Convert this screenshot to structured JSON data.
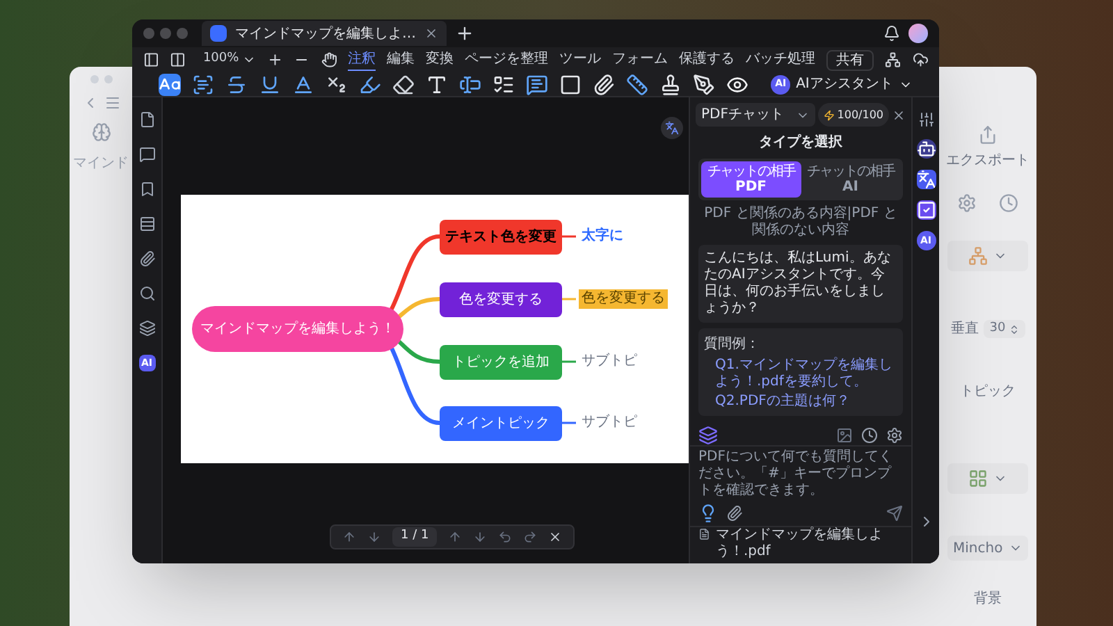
{
  "window": {
    "tab_title": "マインドマップを編集しよ…"
  },
  "zoom": "100%",
  "menu_tabs": [
    {
      "label": "注釈",
      "selected": true
    },
    {
      "label": "編集",
      "selected": false
    },
    {
      "label": "変換",
      "selected": false
    },
    {
      "label": "ページを整理",
      "selected": false
    },
    {
      "label": "ツール",
      "selected": false
    },
    {
      "label": "フォーム",
      "selected": false
    },
    {
      "label": "保護する",
      "selected": false
    },
    {
      "label": "バッチ処理",
      "selected": false
    }
  ],
  "share_button": "共有",
  "ai_assistant": {
    "badge": "AI",
    "label": "AIアシスタント"
  },
  "sidebar_ai": "AI",
  "mind_map": {
    "root": "マインドマップを編集しよう！",
    "branches": [
      {
        "color": "#f0372b"
      },
      {
        "color": "#f5b731"
      },
      {
        "color": "#2aa84a"
      },
      {
        "color": "#3366ff"
      }
    ],
    "topics": [
      {
        "label": "テキスト色を変更",
        "color": "#f0372b",
        "dark_text": true,
        "sub": {
          "label": "太字に",
          "kind": "colored"
        }
      },
      {
        "label": "色を変更する",
        "color": "#7222d8",
        "dark_text": false,
        "sub": {
          "label": "色を変更する",
          "kind": "highlight"
        }
      },
      {
        "label": "トピックを追加",
        "color": "#2aa84a",
        "dark_text": false,
        "sub": {
          "label": "サブトピ",
          "kind": "plain"
        }
      },
      {
        "label": "メイントピック",
        "color": "#3366ff",
        "dark_text": false,
        "sub": {
          "label": "サブトピ",
          "kind": "plain"
        }
      }
    ]
  },
  "page_nav": "1 / 1",
  "chat": {
    "mode": "PDFチャット",
    "credits": "100/100",
    "heading": "タイプを選択",
    "types": [
      {
        "caption": "チャットの相手",
        "label": "PDF",
        "selected": true
      },
      {
        "caption": "チャットの相手",
        "label": "AI",
        "selected": false
      }
    ],
    "note": "PDF と関係のある内容|PDF と関係のない内容",
    "greeting": "こんにちは、私はLumi。あなたのAIアシスタントです。今日は、何のお手伝いをしましょうか？",
    "examples_title": "質問例：",
    "examples": [
      "Q1.マインドマップを編集しよう！.pdfを要約して。",
      "Q2.PDFの主題は何？"
    ],
    "input_placeholder": "PDFについて何でも質問してください。「#」キーでプロンプトを確認できます。",
    "file": "マインドマップを編集しよう！.pdf"
  },
  "strip_ai": "AI",
  "back_window": {
    "side_label": "マインド",
    "export": "エクスポート",
    "spacing_label": "垂直",
    "spacing_value": "30",
    "topic_label": "トピック",
    "font": "Mincho",
    "background_label": "背景"
  }
}
